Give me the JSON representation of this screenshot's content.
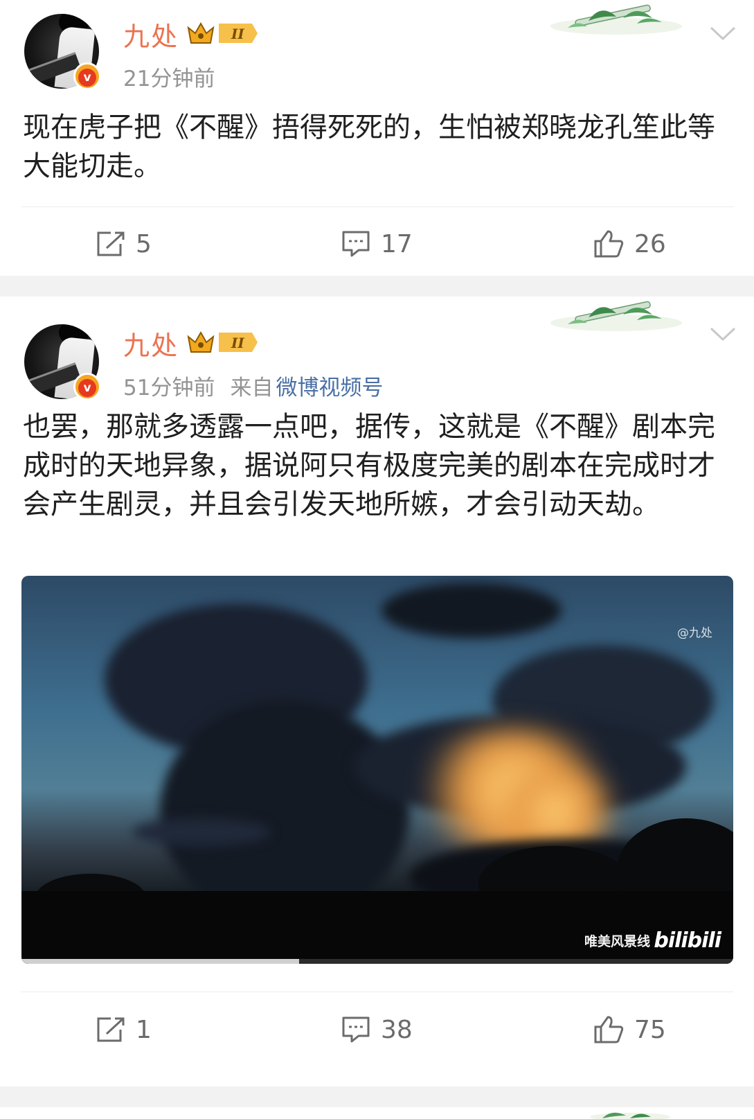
{
  "posts": [
    {
      "username": "九处",
      "vip_level": "II",
      "time": "21分钟前",
      "source_prefix": "",
      "source": "",
      "text": "现在虎子把《不醒》捂得死死的，生怕被郑晓龙孔笙此等大能切走。",
      "actions": {
        "repost": "5",
        "comment": "17",
        "like": "26"
      }
    },
    {
      "username": "九处",
      "vip_level": "II",
      "time": "51分钟前",
      "source_prefix": "来自",
      "source": "微博视频号",
      "text": "也罢，那就多透露一点吧，据传，这就是《不醒》剧本完成时的天地异象，据说阿只有极度完美的剧本在完成时才会产生剧灵，并且会引发天地所嫉，才会引动天劫。",
      "video": {
        "watermark": "@九处",
        "channel": "唯美风景线",
        "platform_logo": "bilibili",
        "progress": 0.39
      },
      "actions": {
        "repost": "1",
        "comment": "38",
        "like": "75"
      }
    }
  ],
  "icons": {
    "verified": "verified-badge-icon",
    "vip": "crown-vip-icon",
    "repost": "repost-icon",
    "comment": "comment-icon",
    "like": "thumbs-up-icon",
    "more": "chevron-down-icon"
  },
  "colors": {
    "username": "#eb7350",
    "meta": "#939393",
    "source_link": "#4a6fa5",
    "verified": "#f5a623"
  }
}
